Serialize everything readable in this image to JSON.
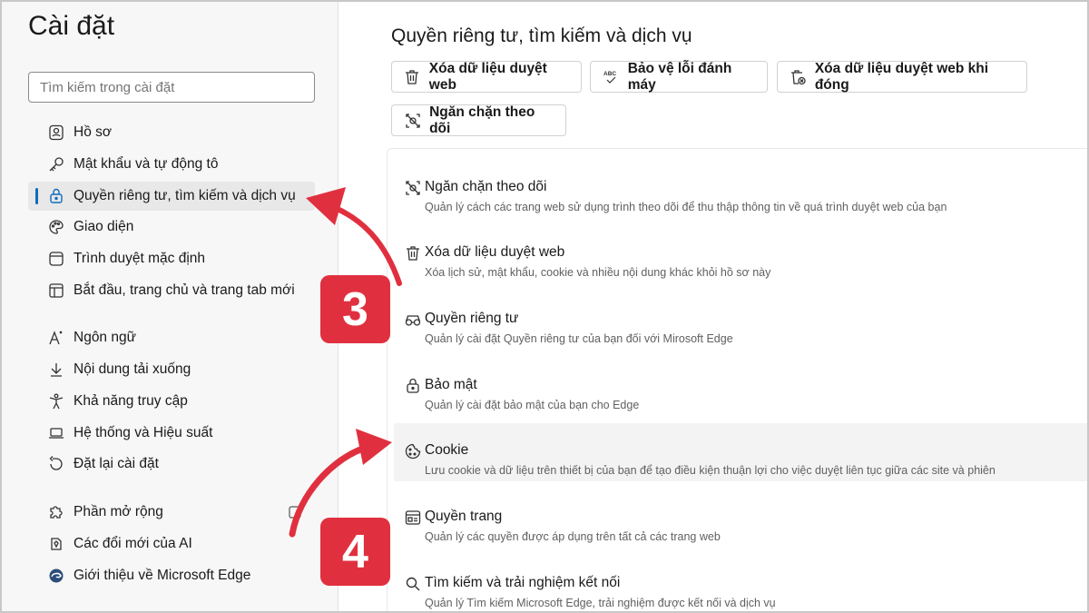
{
  "sidebar": {
    "title": "Cài đặt",
    "search_placeholder": "Tìm kiếm trong cài đặt",
    "items": [
      {
        "label": "Hồ sơ",
        "icon": "profile-icon"
      },
      {
        "label": "Mật khẩu và tự động tô",
        "icon": "key-icon"
      },
      {
        "label": "Quyền riêng tư, tìm kiếm và dịch vụ",
        "icon": "lock-icon",
        "active": true
      },
      {
        "label": "Giao diện",
        "icon": "palette-icon"
      },
      {
        "label": "Trình duyệt mặc định",
        "icon": "browser-icon"
      },
      {
        "label": "Bắt đầu, trang chủ và trang tab mới",
        "icon": "home-tab-icon"
      },
      {
        "label": "Ngôn ngữ",
        "icon": "language-icon"
      },
      {
        "label": "Nội dung tải xuống",
        "icon": "download-icon"
      },
      {
        "label": "Khả năng truy cập",
        "icon": "accessibility-icon"
      },
      {
        "label": "Hệ thống và Hiệu suất",
        "icon": "laptop-icon"
      },
      {
        "label": "Đặt lại cài đặt",
        "icon": "reset-icon"
      },
      {
        "label": "Phần mở rộng",
        "icon": "puzzle-icon"
      },
      {
        "label": "Các đổi mới của AI",
        "icon": "ai-icon"
      },
      {
        "label": "Giới thiệu về Microsoft Edge",
        "icon": "edge-icon"
      }
    ]
  },
  "main": {
    "title": "Quyền riêng tư, tìm kiếm và dịch vụ",
    "quick_buttons": [
      {
        "label": "Xóa dữ liệu duyệt web",
        "icon": "trash-icon"
      },
      {
        "label": "Bảo vệ lỗi đánh máy",
        "icon": "spellcheck-icon"
      },
      {
        "label": "Xóa dữ liệu duyệt web khi đóng",
        "icon": "trash-clock-icon"
      },
      {
        "label": "Ngăn chặn theo dõi",
        "icon": "tracking-icon"
      }
    ],
    "rows": [
      {
        "title": "Ngăn chặn theo dõi",
        "desc": "Quản lý cách các trang web sử dụng trình theo dõi để thu thập thông tin về quá trình duyệt web của bạn",
        "icon": "tracking-icon"
      },
      {
        "title": "Xóa dữ liệu duyệt web",
        "desc": "Xóa lịch sử, mật khẩu, cookie và nhiều nội dung khác khỏi hồ sơ này",
        "icon": "trash-icon"
      },
      {
        "title": "Quyền riêng tư",
        "desc": "Quản lý cài đặt Quyền riêng tư của bạn đối với Mirosoft Edge",
        "icon": "glasses-icon"
      },
      {
        "title": "Bảo mật",
        "desc": "Quản lý cài đặt bảo mật của bạn cho Edge",
        "icon": "lock-icon"
      },
      {
        "title": "Cookie",
        "desc": "Lưu cookie và dữ liệu trên thiết bị của bạn để tạo điều kiện thuận lợi cho việc duyệt liên tục giữa các site và phiên",
        "icon": "cookie-icon",
        "highlighted": true
      },
      {
        "title": "Quyền trang",
        "desc": "Quản lý các quyền được áp dụng trên tất cả các trang web",
        "icon": "site-permissions-icon"
      },
      {
        "title": "Tìm kiếm và trải nghiệm kết nối",
        "desc": "Quản lý Tìm kiếm Microsoft Edge, trải nghiệm được kết nối và dịch vụ",
        "icon": "search-icon"
      }
    ]
  },
  "annotations": {
    "step3": "3",
    "step4": "4",
    "color": "#e0303f"
  }
}
